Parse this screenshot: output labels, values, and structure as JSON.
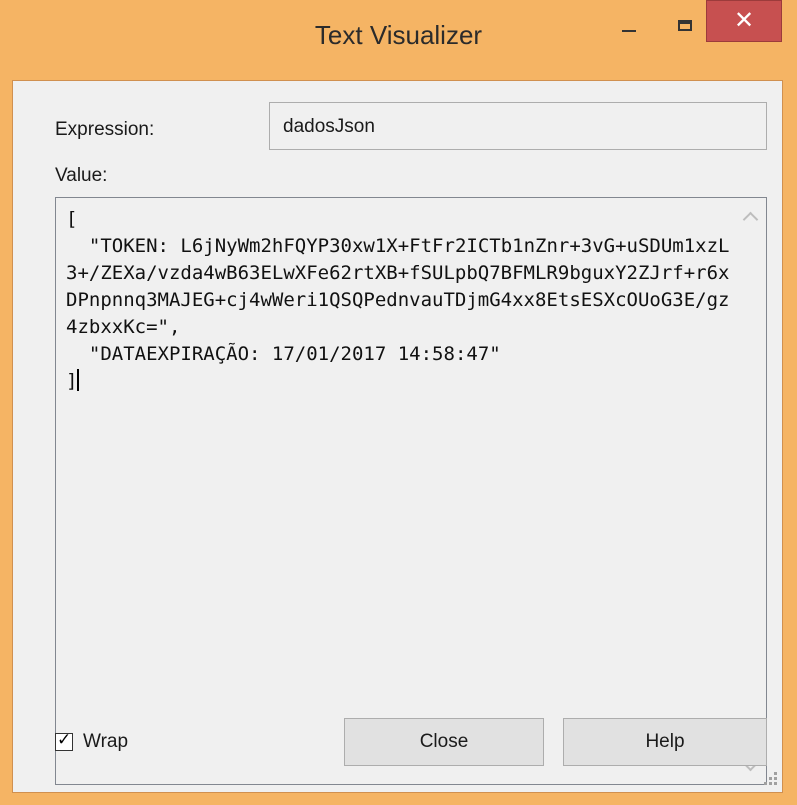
{
  "window": {
    "title": "Text Visualizer",
    "frame_color": "#f5b464",
    "close_color": "#c75050"
  },
  "expression": {
    "label": "Expression:",
    "value": "dadosJson"
  },
  "value": {
    "label": "Value:",
    "text": "[\n  \"TOKEN: L6jNyWm2hFQYP30xw1X+FtFr2ICTb1nZnr+3vG+uSDUm1xzL3+/ZEXa/vzda4wB63ELwXFe62rtXB+fSULpbQ7BFMLR9bguxY2ZJrf+r6xDPnpnnq3MAJEG+cj4wWeri1QSQPednvauTDjmG4xx8EtsESXcOUoG3E/gz4zbxxKc=\",\n  \"DATAEXPIRAÇÃO: 17/01/2017 14:58:47\"\n]"
  },
  "wrap": {
    "label": "Wrap",
    "checked": true
  },
  "buttons": {
    "close": "Close",
    "help": "Help"
  }
}
